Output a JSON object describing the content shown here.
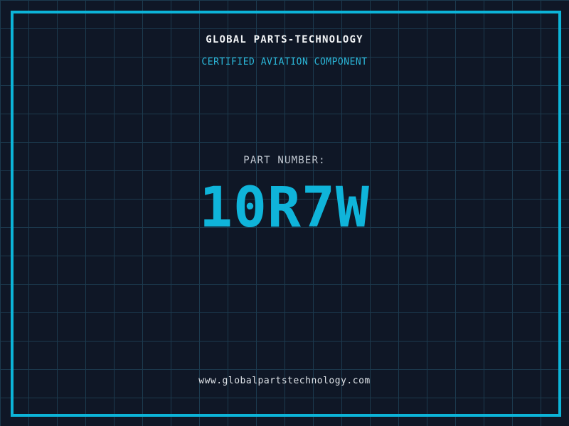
{
  "colors": {
    "background": "#0f1726",
    "grid_line": "#1c3a4e",
    "frame": "#0cb4d8",
    "title": "#f2f4f6",
    "subtitle": "#2bb8da",
    "label": "#c2c9d2",
    "part_number": "#0fb4da",
    "footer": "#dfe3e8"
  },
  "header": {
    "title": "GLOBAL PARTS-TECHNOLOGY",
    "subtitle": "CERTIFIED AVIATION COMPONENT"
  },
  "part": {
    "label": "PART NUMBER:",
    "value": "10R7W"
  },
  "footer": {
    "url": "www.globalpartstechnology.com"
  }
}
